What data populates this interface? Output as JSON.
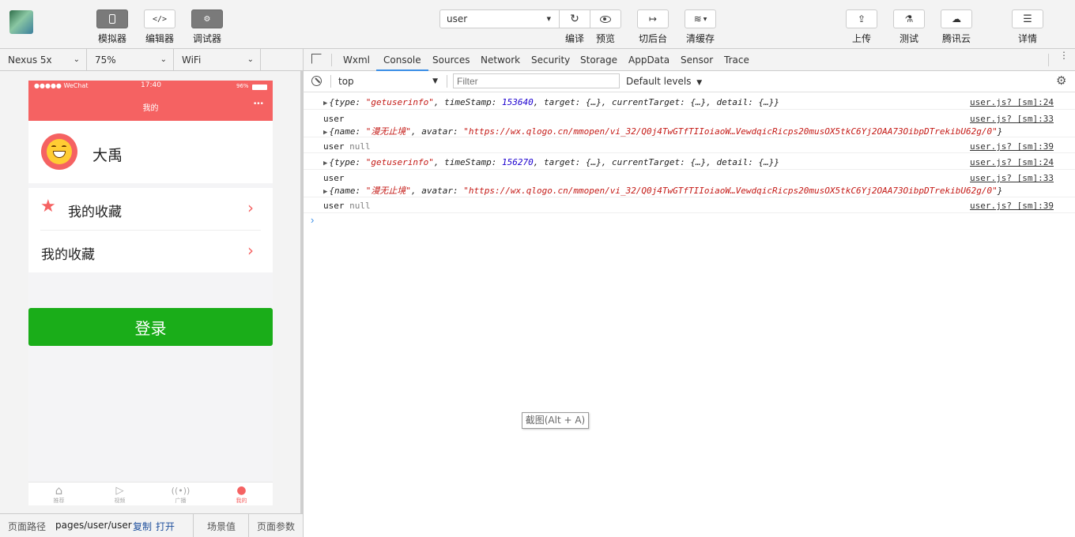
{
  "toolbar": {
    "simulator": "模拟器",
    "editor": "编辑器",
    "debugger": "调试器",
    "compile_mode": "user",
    "compile": "编译",
    "preview": "预览",
    "background": "切后台",
    "clear_cache": "清缓存",
    "upload": "上传",
    "test": "测试",
    "tencent_cloud": "腾讯云",
    "details": "详情"
  },
  "device_bar": {
    "device": "Nexus 5x",
    "zoom": "75%",
    "network": "WiFi"
  },
  "phone": {
    "carrier": "●●●●● WeChat",
    "time": "17:40",
    "battery": "96%",
    "nav_title": "我的",
    "user_name": "大禹",
    "menu_items": [
      {
        "label": "我的收藏",
        "has_star": true
      },
      {
        "label": "我的收藏",
        "has_star": false
      }
    ],
    "login_button": "登录",
    "tabs": [
      "推荐",
      "视频",
      "广播",
      "我的"
    ]
  },
  "footer": {
    "path_label": "页面路径",
    "path_value": "pages/user/user",
    "copy": "复制",
    "open": "打开",
    "scene": "场景值",
    "params": "页面参数"
  },
  "devtools_tabs": [
    "Wxml",
    "Console",
    "Sources",
    "Network",
    "Security",
    "Storage",
    "AppData",
    "Sensor",
    "Trace"
  ],
  "console_filter": {
    "context": "top",
    "filter_placeholder": "Filter",
    "levels": "Default levels"
  },
  "console_rows": [
    {
      "kind": "event",
      "type": "\"getuserinfo\"",
      "timeStamp": "153640",
      "source": "user.js? [sm]:24"
    },
    {
      "kind": "user",
      "label": "user",
      "name": "\"漫无止境\"",
      "avatar": "\"https://wx.qlogo.cn/mmopen/vi_32/Q0j4TwGTfTIIoiaoW…VewdqicRicps20musOX5tkC6Yj2OAA73OibpDTrekibU62g/0\"",
      "source": "user.js? [sm]:33"
    },
    {
      "kind": "null",
      "label": "user",
      "value": "null",
      "source": "user.js? [sm]:39"
    },
    {
      "kind": "event",
      "type": "\"getuserinfo\"",
      "timeStamp": "156270",
      "source": "user.js? [sm]:24"
    },
    {
      "kind": "user",
      "label": "user",
      "name": "\"漫无止境\"",
      "avatar": "\"https://wx.qlogo.cn/mmopen/vi_32/Q0j4TwGTfTIIoiaoW…VewdqicRicps20musOX5tkC6Yj2OAA73OibpDTrekibU62g/0\"",
      "source": "user.js? [sm]:33"
    },
    {
      "kind": "null",
      "label": "user",
      "value": "null",
      "source": "user.js? [sm]:39"
    }
  ],
  "tooltip": "截图(Alt + A)",
  "colors": {
    "nav_red": "#f56262",
    "login_green": "#1aad19",
    "active_tab_blue": "#3a8ee6"
  }
}
